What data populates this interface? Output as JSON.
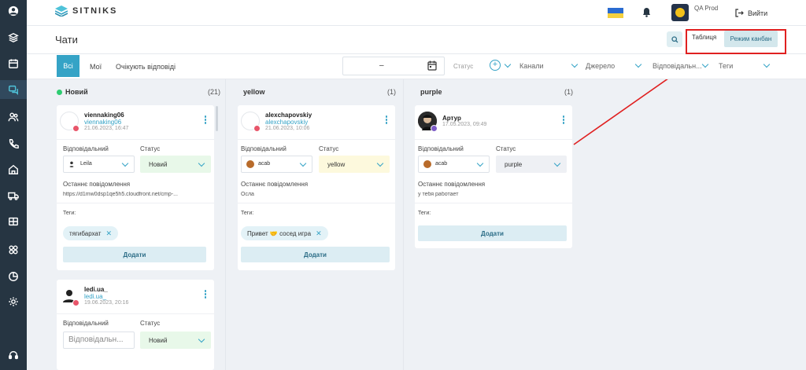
{
  "app": {
    "logo_text": "SITNIKS"
  },
  "sidebar": {
    "items": [
      {
        "icon": "profile-icon"
      },
      {
        "icon": "layers-icon"
      },
      {
        "icon": "calendar-icon"
      },
      {
        "icon": "chat-icon",
        "active": true
      },
      {
        "icon": "users-icon"
      },
      {
        "icon": "phone-icon"
      },
      {
        "icon": "home-icon"
      },
      {
        "icon": "truck-icon"
      },
      {
        "icon": "box-icon"
      },
      {
        "icon": "integrations-icon"
      },
      {
        "icon": "analytics-icon"
      },
      {
        "icon": "settings-icon"
      },
      {
        "icon": "headset-icon"
      }
    ]
  },
  "topbar": {
    "user_name": "QA Prod",
    "logout_label": "Вийти"
  },
  "header": {
    "title": "Чати",
    "tab_table": "Таблиця",
    "tab_kanban": "Режим канбан"
  },
  "filters": {
    "tab_all": "Всі",
    "tab_mine": "Мої",
    "tab_waiting": "Очікують відповіді",
    "date_separator": "–",
    "status_label": "Статус",
    "channels": "Канали",
    "source": "Джерело",
    "responsible": "Відповідальн...",
    "tags": "Теги"
  },
  "columns": [
    {
      "name": "Новий",
      "count": "(21)",
      "cards": [
        {
          "name": "viennaking06",
          "sub": "viennaking06",
          "date": "21.06.2023, 16:47",
          "responsible_label": "Відповідальний",
          "status_label": "Статус",
          "responsible": "Leila",
          "status": "Новий",
          "last_msg_label": "Останнє повідомлення",
          "last_msg": "https://d1mw0dsp1qe5h5.cloudfront.net/cmp-...",
          "tags_label": "Теги:",
          "tag": "тягибархат",
          "add_label": "Додати"
        },
        {
          "name": "ledi.ua_",
          "sub": "ledi.ua_",
          "date": "19.06.2023, 20:16",
          "responsible_label": "Відповідальний",
          "status_label": "Статус",
          "responsible_placeholder": "Відповідальн...",
          "status": "Новий"
        }
      ]
    },
    {
      "name": "yellow",
      "count": "(1)",
      "cards": [
        {
          "name": "alexchapovskiy",
          "sub": "alexchapovskiy",
          "date": "21.06.2023, 10:06",
          "responsible_label": "Відповідальний",
          "status_label": "Статус",
          "responsible": "acab",
          "status": "yellow",
          "last_msg_label": "Останнє повідомлення",
          "last_msg": "Осла",
          "tags_label": "Теги:",
          "tag": "Привет 🤝 сосед игра",
          "add_label": "Додати"
        }
      ]
    },
    {
      "name": "purple",
      "count": "(1)",
      "cards": [
        {
          "name": "Артур",
          "date": "17.05.2023, 09:49",
          "responsible_label": "Відповідальний",
          "status_label": "Статус",
          "responsible": "acab",
          "status": "purple",
          "last_msg_label": "Останнє повідомлення",
          "last_msg": "у тебя работает",
          "tags_label": "Теги:",
          "add_label": "Додати"
        }
      ]
    }
  ],
  "colors": {
    "accent": "#35a3c6",
    "sidebar": "#263542",
    "highlight": "#e02020"
  }
}
